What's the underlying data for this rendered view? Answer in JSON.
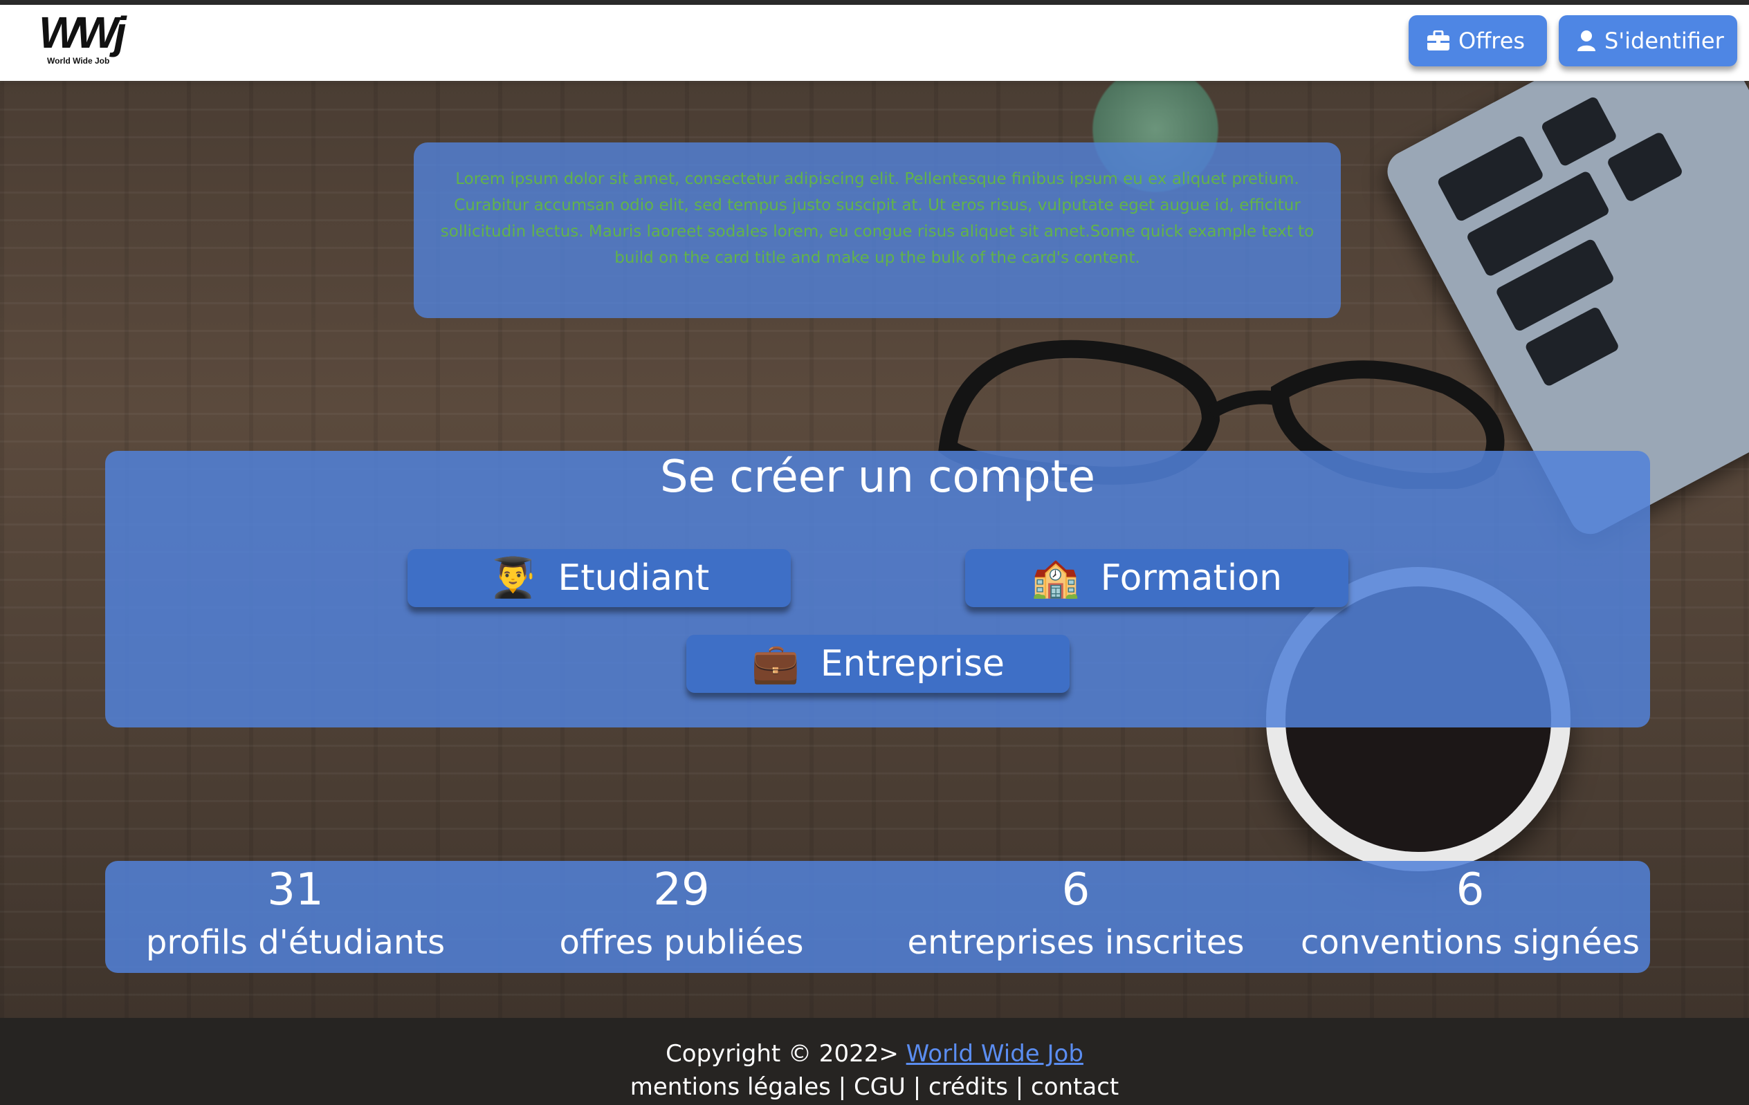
{
  "nav": {
    "logo_text": "WWj",
    "logo_subtitle": "World Wide Job",
    "offers_label": "Offres",
    "login_label": "S'identifier",
    "offers_icon": "briefcase-icon",
    "login_icon": "user-icon"
  },
  "intro": {
    "text": "Lorem ipsum dolor sit amet, consectetur adipiscing elit. Pellentesque finibus ipsum eu ex aliquet pretium. Curabitur accumsan odio elit, sed tempus justo suscipit at. Ut eros risus, vulputate eget augue id, efficitur sollicitudin lectus. Mauris laoreet sodales lorem, eu congue risus aliquet sit amet.Some quick example text to build on the card title and make up the bulk of the card's content."
  },
  "signup": {
    "title": "Se créer un compte",
    "buttons": [
      {
        "label": "Etudiant",
        "emoji": "👨‍🎓"
      },
      {
        "label": "Formation",
        "emoji": "🏫"
      },
      {
        "label": "Entreprise",
        "emoji": "💼"
      }
    ]
  },
  "stats": [
    {
      "value": "31",
      "label": "profils d'étudiants"
    },
    {
      "value": "29",
      "label": "offres publiées"
    },
    {
      "value": "6",
      "label": "entreprises inscrites"
    },
    {
      "value": "6",
      "label": "conventions signées"
    }
  ],
  "footer": {
    "copyright": "Copyright © 2022>",
    "brand_link": "World Wide Job",
    "links": [
      "mentions légales",
      "CGU",
      "crédits",
      "contact"
    ],
    "separator": " | "
  },
  "colors": {
    "panel": "#5281d8",
    "button": "#3e6fc6",
    "nav_button": "#4e86e4",
    "intro_text": "#62b34a",
    "footer_bg": "#262422",
    "link": "#5b8df0"
  }
}
